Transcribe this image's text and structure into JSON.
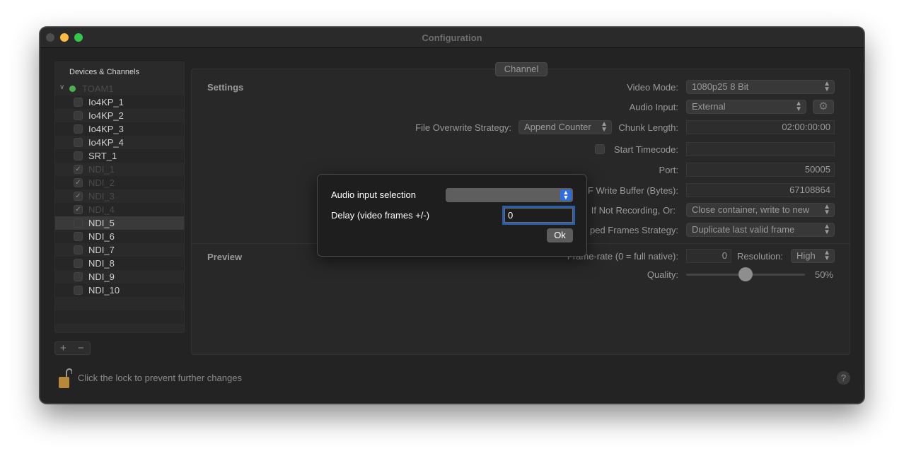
{
  "window": {
    "title": "Configuration"
  },
  "sidebar": {
    "header": "Devices & Channels",
    "group": "TOAM1",
    "items": [
      {
        "label": "Io4KP_1",
        "checked": false,
        "dim": false
      },
      {
        "label": "Io4KP_2",
        "checked": false,
        "dim": false
      },
      {
        "label": "Io4KP_3",
        "checked": false,
        "dim": false
      },
      {
        "label": "Io4KP_4",
        "checked": false,
        "dim": false
      },
      {
        "label": "SRT_1",
        "checked": false,
        "dim": false
      },
      {
        "label": "NDI_1",
        "checked": true,
        "dim": true
      },
      {
        "label": "NDI_2",
        "checked": true,
        "dim": true
      },
      {
        "label": "NDI_3",
        "checked": true,
        "dim": true
      },
      {
        "label": "NDI_4",
        "checked": true,
        "dim": true
      },
      {
        "label": "NDI_5",
        "checked": false,
        "dim": false
      },
      {
        "label": "NDI_6",
        "checked": false,
        "dim": false
      },
      {
        "label": "NDI_7",
        "checked": false,
        "dim": false
      },
      {
        "label": "NDI_8",
        "checked": false,
        "dim": false
      },
      {
        "label": "NDI_9",
        "checked": false,
        "dim": false
      },
      {
        "label": "NDI_10",
        "checked": false,
        "dim": false
      }
    ],
    "add_label": "+",
    "remove_label": "−"
  },
  "main": {
    "channel_tab": "Channel",
    "settings": {
      "title": "Settings",
      "video_mode_label": "Video Mode:",
      "video_mode_value": "1080p25 8 Bit",
      "audio_input_label": "Audio Input:",
      "audio_input_value": "External",
      "overwrite_label": "File Overwrite Strategy:",
      "overwrite_value": "Append Counter",
      "chunk_label": "Chunk Length:",
      "chunk_value": "02:00:00:00",
      "start_tc_label": "Start Timecode:",
      "start_tc_value": "",
      "port_label": "Port:",
      "port_value": "50005",
      "buffer_label": "F Write Buffer (Bytes):",
      "buffer_value": "67108864",
      "not_recording_label": "If Not Recording, Or:",
      "not_recording_value": "Close container, write to new",
      "dropped_label": "ped Frames Strategy:",
      "dropped_value": "Duplicate last valid frame"
    },
    "preview": {
      "title": "Preview",
      "framerate_label": "Frame-rate (0 = full native):",
      "framerate_value": "0",
      "resolution_label": "Resolution:",
      "resolution_value": "High",
      "quality_label": "Quality:",
      "quality_value": "50%",
      "quality_fraction": 0.5
    }
  },
  "footer": {
    "lock_text": "Click the lock to prevent further changes",
    "help_label": "?"
  },
  "dialog": {
    "audio_label": "Audio input selection",
    "audio_value": "",
    "delay_label": "Delay (video frames +/-)",
    "delay_value": "0",
    "ok_label": "Ok"
  }
}
